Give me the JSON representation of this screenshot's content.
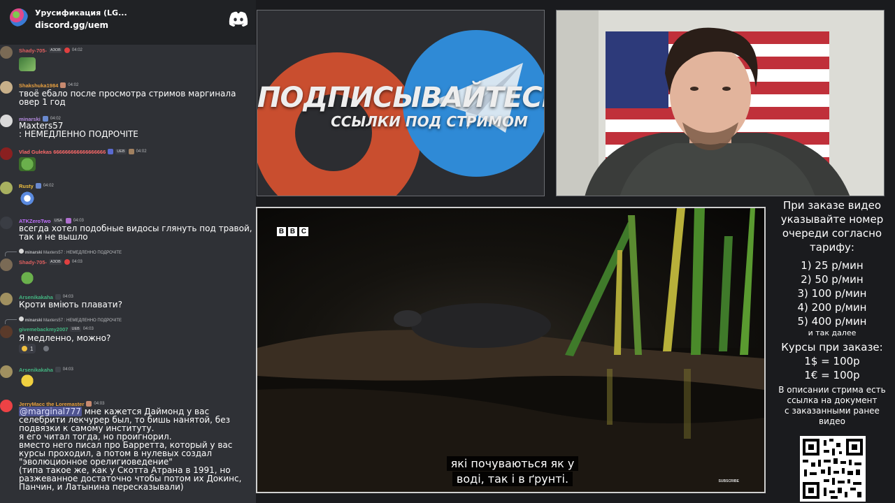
{
  "chat": {
    "server_name": "Урусификация (LG...",
    "invite": "discord.gg/uem",
    "messages": [
      {
        "user": "Shady-705-",
        "tag": "АЗОВ",
        "time": "04:02"
      },
      {
        "user": "Shakshuka1984",
        "time": "04:02",
        "text": "твоё ебало после просмотра стримов маргинала овер 1 год"
      },
      {
        "user": "minarski",
        "time": "04:02",
        "text": "Maxters57\n: НЕМЕДЛЕННО ПОДРОЧITE"
      },
      {
        "user": "Vlad Gulekas 666666666666666666",
        "tag": "UEB",
        "time": "04:02"
      },
      {
        "user": "Rusty",
        "time": "04:02"
      },
      {
        "user": "ATKZeroTwo",
        "tag": "USA",
        "time": "04:03",
        "text": "всегда хотел подобные видосы глянуть под травой, так и не вышло"
      },
      {
        "reply_user": "minarski",
        "reply_text": "Maxters57 : НЕМЕДЛЕННО ПОДРОЧІТЕ",
        "user": "Shady-705-",
        "tag": "АЗОВ",
        "time": "04:03"
      },
      {
        "user": "Arsenikakaha",
        "time": "04:03",
        "text": "Кроти вміють плавати?"
      },
      {
        "reply_user": "minarski",
        "reply_text": "Maxters57 : НЕМЕДЛЕННО ПОДРОЧІТЕ",
        "user": "givemebackmy2007",
        "tag": "UEB",
        "time": "04:03",
        "text": "Я медленно, можно?",
        "reaction_count": "1"
      },
      {
        "user": "Arsenikakaha",
        "time": "04:03"
      },
      {
        "user": "JerryMacc the Loremaster",
        "time": "04:03",
        "mention": "@marginal777",
        "text": "мне кажется Даймонд у вас селебрити лекчурер был, то бишь нанятой, без подвязки к самому институту.\nя его читал тогда, но проигнорил.\nвместо него писал про Барретта, который у вас курсы проходил, а потом в нулевых создал \"эволюционное орелигиоведение\"\n(типа такое же, как у Скотта Атрана в 1991, но разжеванное достаточно чтобы потом их Докинс, Панчин, и Латынина пересказывали)"
      }
    ]
  },
  "promo": {
    "title": "ПОДПИСЫВАЙТЕСЬ",
    "subtitle": "ССЫЛКИ ПОД СТРИМОМ"
  },
  "video": {
    "logo": [
      "B",
      "B",
      "C"
    ],
    "subtitle_line1": "які почуваються як у",
    "subtitle_line2": "воді, так і в ґрунті.",
    "subscribe": "SUBSCRIBE"
  },
  "info": {
    "intro": [
      "При заказе видео",
      "указывайте номер",
      "очереди согласно",
      "тарифу:"
    ],
    "tariffs": [
      "1) 25 р/мин",
      "2) 50 р/мин",
      "3) 100 р/мин",
      "4) 200 р/мин",
      "5) 400 р/мин"
    ],
    "etc": "и так далее",
    "rates_title": "Курсы при заказе:",
    "rates": [
      "1$ = 100р",
      "1€ = 100р"
    ],
    "note": [
      "В описании стрима есть",
      "ссылка на документ",
      "с заказанными ранее",
      "видео"
    ]
  },
  "colors": {
    "chat_bg": "#2f3136",
    "header_bg": "#202225",
    "patreon": "#c94e2f",
    "telegram": "#2f8ad6"
  }
}
